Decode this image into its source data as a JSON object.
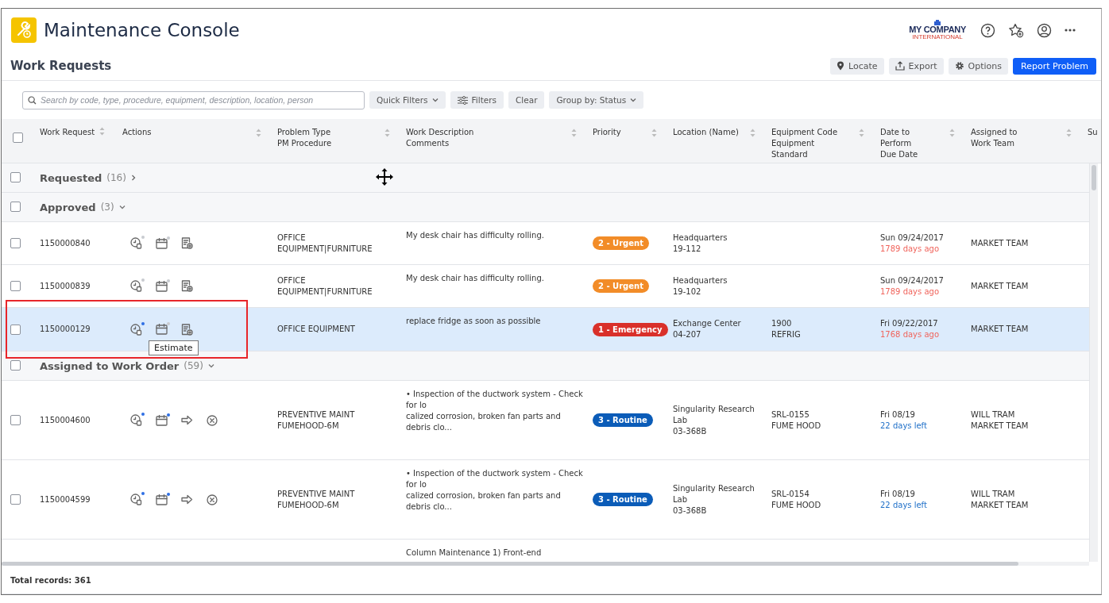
{
  "app": {
    "title": "Maintenance Console"
  },
  "company_logo": {
    "name": "MY COMPANY",
    "tagline": "INTERNATIONAL"
  },
  "page_title": "Work Requests",
  "page_actions": [
    {
      "label": "Locate",
      "primary": false
    },
    {
      "label": "Export",
      "primary": false
    },
    {
      "label": "Options",
      "primary": false
    },
    {
      "label": "Report Problem",
      "primary": true
    }
  ],
  "search": {
    "placeholder": "Search by code, type, procedure, equipment, description, location, person"
  },
  "toolbar": [
    {
      "label": "Quick Filters",
      "kind": "dropdown"
    },
    {
      "label": "Filters",
      "kind": "filter"
    },
    {
      "label": "Clear",
      "kind": "plain"
    },
    {
      "label": "Group by: Status",
      "kind": "dropdown"
    }
  ],
  "table": {
    "all_checked": false,
    "columns": [
      {
        "lines": [
          "Work Request"
        ]
      },
      {
        "lines": [
          "Actions"
        ]
      },
      {
        "lines": [
          "Problem Type",
          "PM Procedure"
        ]
      },
      {
        "lines": [
          "Work Description",
          "Comments"
        ]
      },
      {
        "lines": [
          "Priority"
        ]
      },
      {
        "lines": [
          "Location (Name)"
        ]
      },
      {
        "lines": [
          "Equipment Code",
          "Equipment",
          "Standard"
        ]
      },
      {
        "lines": [
          "Date to",
          "Perform",
          "Due Date"
        ]
      },
      {
        "lines": [
          "Assigned to",
          "Work Team"
        ]
      },
      {
        "lines": [
          "Su"
        ]
      }
    ],
    "groups": [
      {
        "label": "Requested",
        "count": "(16)",
        "checked": false,
        "expanded": false
      },
      {
        "label": "Approved",
        "count": "(3)",
        "checked": false,
        "expanded": true,
        "rows": [
          {
            "id": "1150000840",
            "checked": false,
            "selected": false,
            "actions": [
              {
                "kind": "estimate",
                "flagged": false
              },
              {
                "kind": "schedule",
                "flagged": false
              },
              {
                "kind": "add-document"
              }
            ],
            "problem": [
              "OFFICE",
              "EQUIPMENT|FURNITURE"
            ],
            "description": [
              "My desk chair has difficulty rolling."
            ],
            "priority": {
              "label": "2 - Urgent",
              "color": "#f28c28"
            },
            "location": [
              "Headquarters",
              "19-112"
            ],
            "date": "Sun 09/24/2017",
            "due": {
              "text": "1789 days ago",
              "overdue": true
            },
            "assigned": [
              "MARKET TEAM"
            ]
          },
          {
            "id": "1150000839",
            "checked": false,
            "selected": false,
            "actions": [
              {
                "kind": "estimate",
                "flagged": false
              },
              {
                "kind": "schedule",
                "flagged": false
              },
              {
                "kind": "add-document"
              }
            ],
            "problem": [
              "OFFICE",
              "EQUIPMENT|FURNITURE"
            ],
            "description": [
              "My desk chair has difficulty rolling."
            ],
            "priority": {
              "label": "2 - Urgent",
              "color": "#f28c28"
            },
            "location": [
              "Headquarters",
              "19-102"
            ],
            "date": "Sun 09/24/2017",
            "due": {
              "text": "1789 days ago",
              "overdue": true
            },
            "assigned": [
              "MARKET TEAM"
            ]
          },
          {
            "id": "1150000129",
            "checked": false,
            "selected": true,
            "outlined": true,
            "tooltip": "Estimate",
            "actions": [
              {
                "kind": "estimate",
                "flagged": true
              },
              {
                "kind": "schedule",
                "flagged": false
              },
              {
                "kind": "add-document"
              }
            ],
            "problem": [
              "OFFICE EQUIPMENT"
            ],
            "description": [
              "replace fridge as soon as possible"
            ],
            "priority": {
              "label": "1 - Emergency",
              "color": "#d9302a"
            },
            "location": [
              "Exchange Center",
              "04-207"
            ],
            "equipment": [
              "1900",
              "REFRIG"
            ],
            "date": "Fri 09/22/2017",
            "due": {
              "text": "1768 days ago",
              "overdue": true
            },
            "assigned": [
              "MARKET TEAM"
            ]
          }
        ]
      },
      {
        "label": "Assigned to Work Order",
        "count": "(59)",
        "checked": false,
        "expanded": true,
        "rows": [
          {
            "id": "1150004600",
            "checked": false,
            "selected": false,
            "actions": [
              {
                "kind": "estimate",
                "flagged": true
              },
              {
                "kind": "schedule",
                "flagged": true
              },
              {
                "kind": "forward"
              },
              {
                "kind": "cancel"
              }
            ],
            "problem": [
              "PREVENTIVE MAINT",
              "FUMEHOOD-6M"
            ],
            "description": [
              "• Inspection of the ductwork system - Check",
              "for lo",
              "calized corrosion, broken fan parts and",
              "debris clo..."
            ],
            "priority": {
              "label": "3 - Routine",
              "color": "#0b5cb8"
            },
            "location": [
              "Singularity Research",
              "Lab",
              "03-368B"
            ],
            "equipment": [
              "SRL-0155",
              "FUME HOOD"
            ],
            "date": "Fri 08/19",
            "due": {
              "text": "22 days left",
              "overdue": false
            },
            "assigned": [
              "WILL TRAM",
              "MARKET TEAM"
            ]
          },
          {
            "id": "1150004599",
            "checked": false,
            "selected": false,
            "actions": [
              {
                "kind": "estimate",
                "flagged": true
              },
              {
                "kind": "schedule",
                "flagged": true
              },
              {
                "kind": "forward"
              },
              {
                "kind": "cancel"
              }
            ],
            "problem": [
              "PREVENTIVE MAINT",
              "FUMEHOOD-6M"
            ],
            "description": [
              "• Inspection of the ductwork system - Check",
              "for lo",
              "calized corrosion, broken fan parts and",
              "debris clo..."
            ],
            "priority": {
              "label": "3 - Routine",
              "color": "#0b5cb8"
            },
            "location": [
              "Singularity Research",
              "Lab",
              "03-368B"
            ],
            "equipment": [
              "SRL-0154",
              "FUME HOOD"
            ],
            "date": "Fri 08/19",
            "due": {
              "text": "22 days left",
              "overdue": false
            },
            "assigned": [
              "WILL TRAM",
              "MARKET TEAM"
            ]
          },
          {
            "selected": false,
            "description": [
              "Column Maintenance 1) Front-end"
            ]
          }
        ]
      }
    ]
  },
  "footer": {
    "total": "Total records: 361"
  }
}
